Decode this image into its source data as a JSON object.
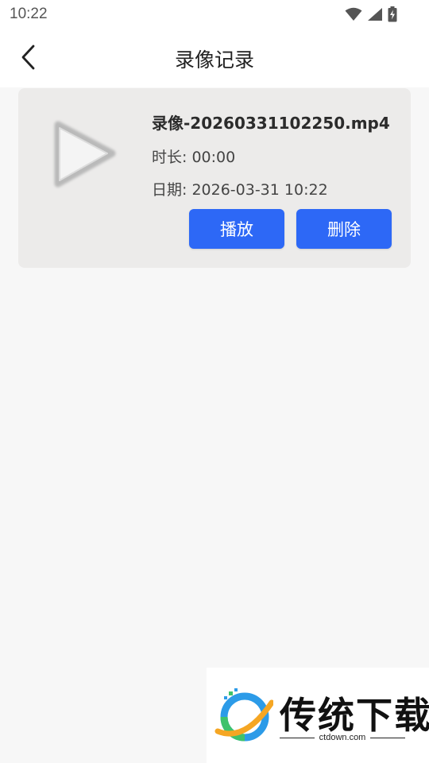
{
  "status_bar": {
    "time": "10:22",
    "icons": [
      "wifi-icon",
      "signal-icon",
      "battery-charging-icon"
    ]
  },
  "header": {
    "title": "录像记录",
    "back_icon": "chevron-left-icon"
  },
  "records": [
    {
      "file_name": "录像-20260331102250.mp4",
      "duration": "时长: 00:00",
      "date": "日期: 2026-03-31 10:22",
      "play_label": "播放",
      "delete_label": "删除",
      "thumb_icon": "play-triangle-icon"
    }
  ],
  "watermark": {
    "brand": "传统下载",
    "domain": "ctdown.com"
  },
  "colors": {
    "accent": "#2d68f6",
    "card_bg": "#ecebea",
    "page_bg": "#f7f7f7"
  }
}
